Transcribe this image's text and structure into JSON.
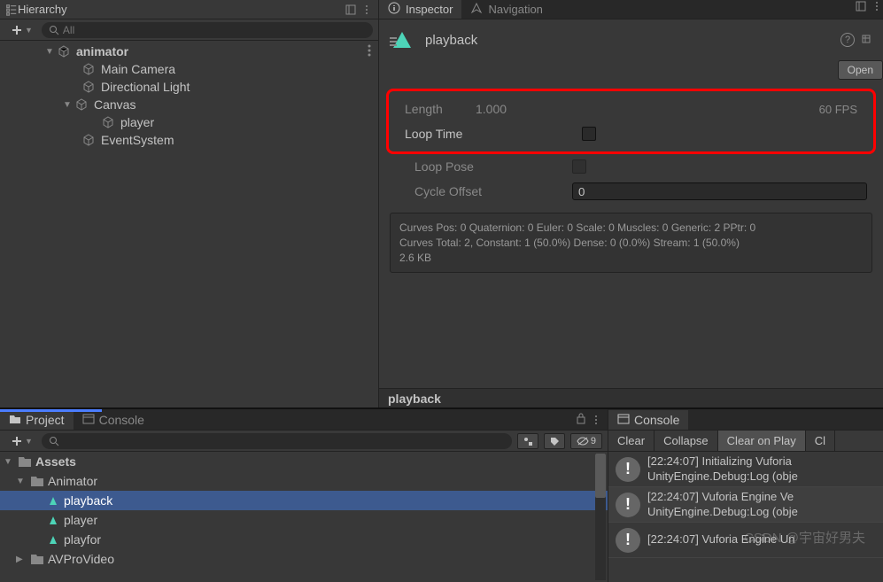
{
  "hierarchy": {
    "title": "Hierarchy",
    "search_placeholder": "All",
    "root": "animator",
    "items": [
      "Main Camera",
      "Directional Light",
      "Canvas",
      "player",
      "EventSystem"
    ]
  },
  "inspector": {
    "tabs": {
      "inspector": "Inspector",
      "navigation": "Navigation"
    },
    "clip_name": "playback",
    "open_button": "Open",
    "length_label": "Length",
    "length_value": "1.000",
    "fps": "60 FPS",
    "loop_time": "Loop Time",
    "loop_pose": "Loop Pose",
    "cycle_offset_label": "Cycle Offset",
    "cycle_offset_value": "0",
    "curves_text": "Curves Pos: 0 Quaternion: 0 Euler: 0 Scale: 0 Muscles: 0 Generic: 2 PPtr: 0\nCurves Total: 2, Constant: 1 (50.0%) Dense: 0 (0.0%) Stream: 1 (50.0%)\n2.6 KB",
    "preview_title": "playback"
  },
  "project": {
    "tabs": {
      "project": "Project",
      "console": "Console"
    },
    "hidden_count": "9",
    "assets": "Assets",
    "folders": [
      "Animator"
    ],
    "clips": [
      "playback",
      "player",
      "playfor"
    ],
    "avpro": "AVProVideo"
  },
  "console": {
    "title": "Console",
    "buttons": {
      "clear": "Clear",
      "collapse": "Collapse",
      "clear_on_play": "Clear on Play",
      "cl": "Cl"
    },
    "logs": [
      {
        "time": "[22:24:07]",
        "msg": "Initializing Vuforia",
        "detail": "UnityEngine.Debug:Log (obje"
      },
      {
        "time": "[22:24:07]",
        "msg": "Vuforia Engine Ve",
        "detail": "UnityEngine.Debug:Log (obje"
      },
      {
        "time": "[22:24:07]",
        "msg": "Vuforia Engine Un",
        "detail": ""
      }
    ]
  },
  "watermark": "CSDN @宇宙好男夫"
}
